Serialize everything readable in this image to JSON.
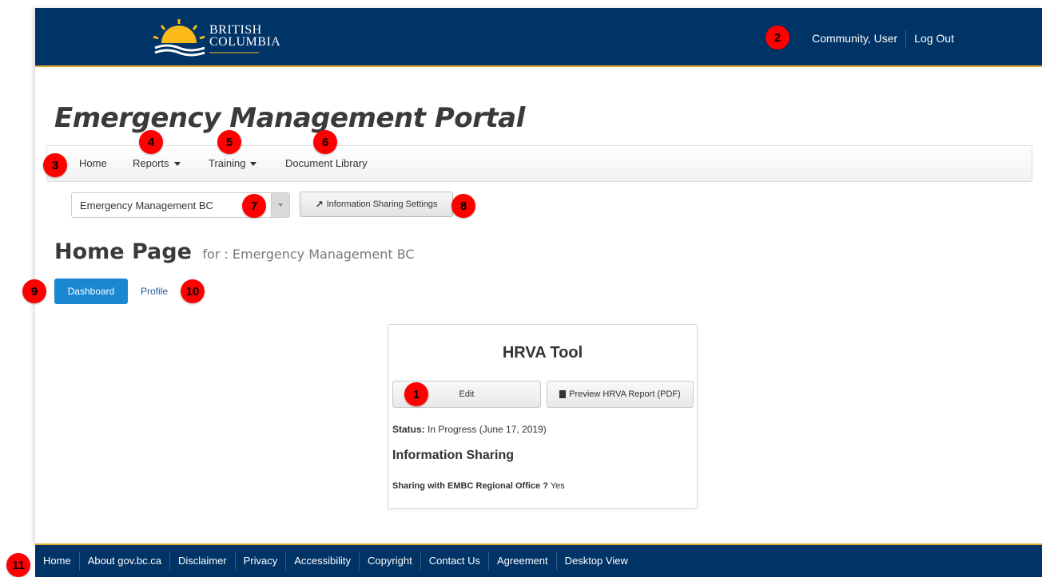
{
  "header": {
    "logo_line1": "BRITISH",
    "logo_line2": "COLUMBIA",
    "user_name": "Community, User",
    "logout": "Log Out"
  },
  "page_title": "Emergency Management Portal",
  "nav": {
    "home": "Home",
    "reports": "Reports",
    "training": "Training",
    "library": "Document Library"
  },
  "org_select": {
    "value": "Emergency Management BC"
  },
  "sharing_settings_label": "Information Sharing Settings",
  "home": {
    "title": "Home Page",
    "subtitle": "for : Emergency Management BC",
    "tab_dashboard": "Dashboard",
    "tab_profile": "Profile"
  },
  "card": {
    "title": "HRVA Tool",
    "edit": "Edit",
    "preview": "Preview HRVA Report (PDF)",
    "status_label": "Status:",
    "status_value": "In Progress (June 17, 2019)",
    "info_heading": "Information Sharing",
    "sharing_label": "Sharing with EMBC Regional Office ?",
    "sharing_value": "Yes"
  },
  "footer": {
    "links": [
      "Home",
      "About gov.bc.ca",
      "Disclaimer",
      "Privacy",
      "Accessibility",
      "Copyright",
      "Contact Us",
      "Agreement",
      "Desktop View"
    ]
  },
  "callouts": [
    "1",
    "2",
    "3",
    "4",
    "5",
    "6",
    "7",
    "8",
    "9",
    "10",
    "11"
  ],
  "colors": {
    "header_bg": "#003366",
    "accent_gold": "#e3a82b",
    "primary_button": "#1a87d1",
    "callout": "#ff0000"
  }
}
